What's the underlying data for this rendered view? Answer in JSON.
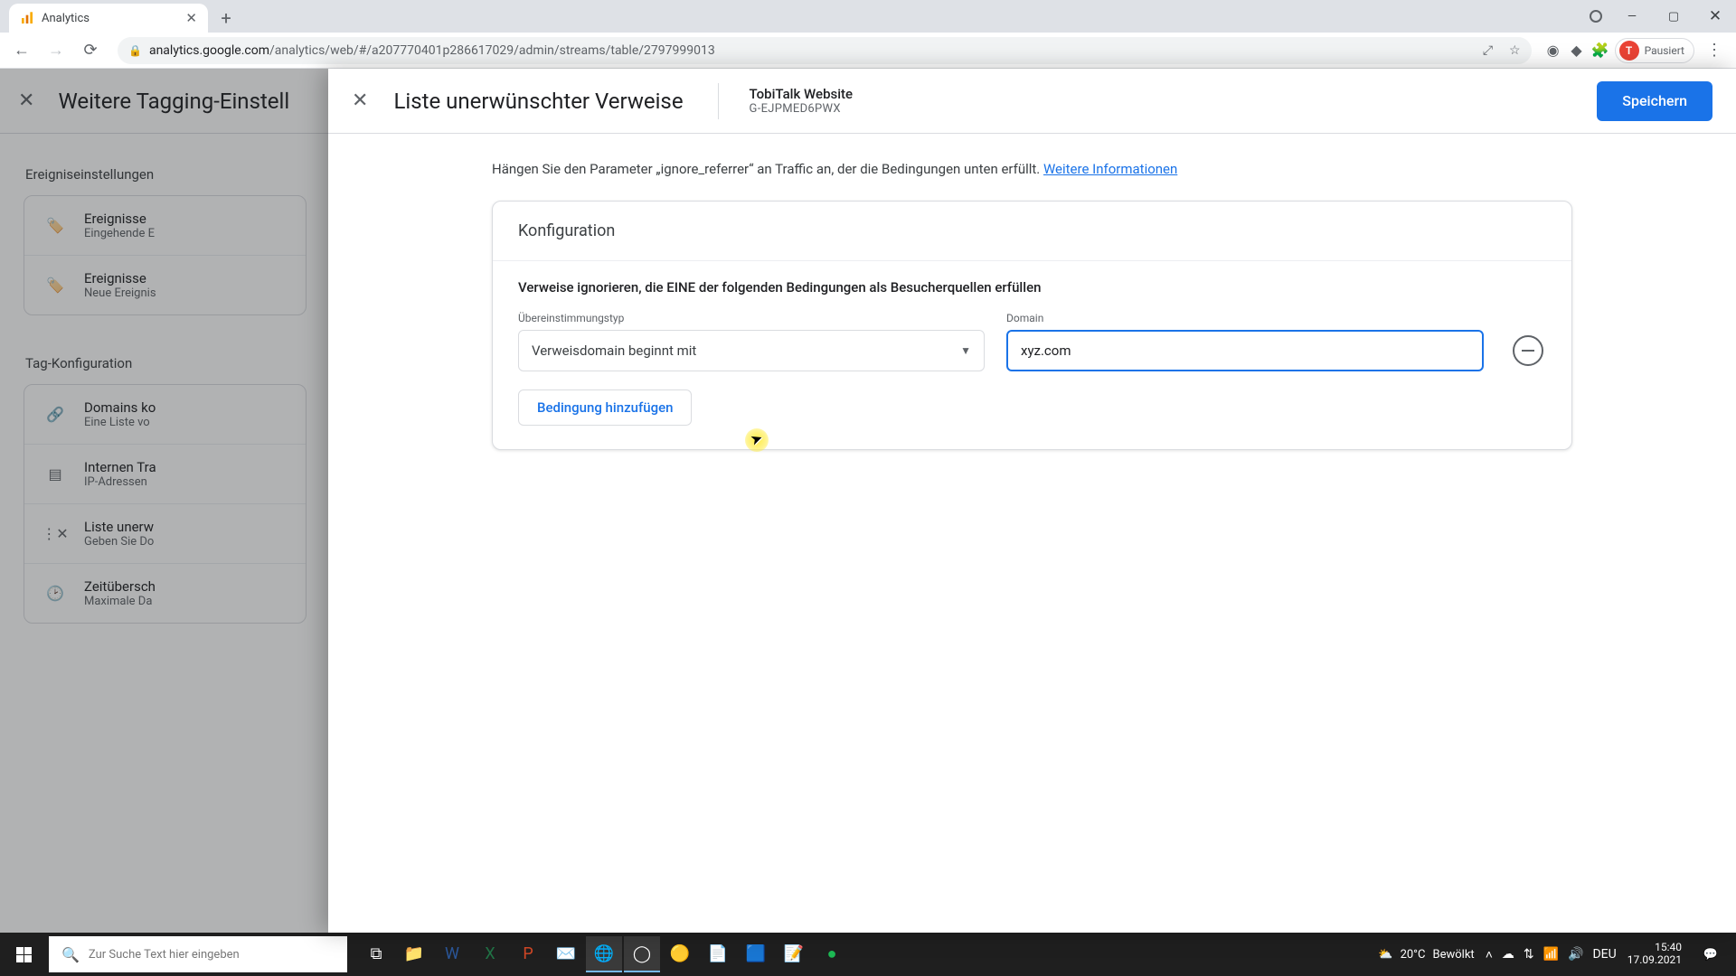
{
  "browser": {
    "tab_title": "Analytics",
    "url_host": "analytics.google.com",
    "url_path": "/analytics/web/#/a207770401p286617029/admin/streams/table/2797999013",
    "profile_label": "Pausiert",
    "profile_initial": "T"
  },
  "panel_back": {
    "title": "Weitere Tagging-Einstell",
    "section1": "Ereigniseinstellungen",
    "rows1": [
      {
        "t1": "Ereignisse",
        "t2": "Eingehende E"
      },
      {
        "t1": "Ereignisse",
        "t2": "Neue Ereignis"
      }
    ],
    "section2": "Tag-Konfiguration",
    "rows2": [
      {
        "t1": "Domains ko",
        "t2": "Eine Liste vo"
      },
      {
        "t1": "Internen Tra",
        "t2": "IP-Adressen"
      },
      {
        "t1": "Liste unerw",
        "t2": "Geben Sie Do"
      },
      {
        "t1": "Zeitübersch",
        "t2": "Maximale Da"
      }
    ]
  },
  "panel_front": {
    "title": "Liste unerwünschter Verweise",
    "property_name": "TobiTalk Website",
    "property_id": "G-EJPMED6PWX",
    "save_label": "Speichern",
    "intro_text": "Hängen Sie den Parameter „ignore_referrer“ an Traffic an, der die Bedingungen unten erfüllt. ",
    "intro_link": "Weitere Informationen",
    "card_title": "Konfiguration",
    "card_subtitle": "Verweise ignorieren, die EINE der folgenden Bedingungen als Besucherquellen erfüllen",
    "match_label": "Übereinstimmungstyp",
    "match_value": "Verweisdomain beginnt mit",
    "domain_label": "Domain",
    "domain_value": "xyz.com",
    "add_condition_label": "Bedingung hinzufügen"
  },
  "taskbar": {
    "search_placeholder": "Zur Suche Text hier eingeben",
    "weather_temp": "20°C",
    "weather_text": "Bewölkt",
    "lang": "DEU",
    "time": "15:40",
    "date": "17.09.2021"
  }
}
